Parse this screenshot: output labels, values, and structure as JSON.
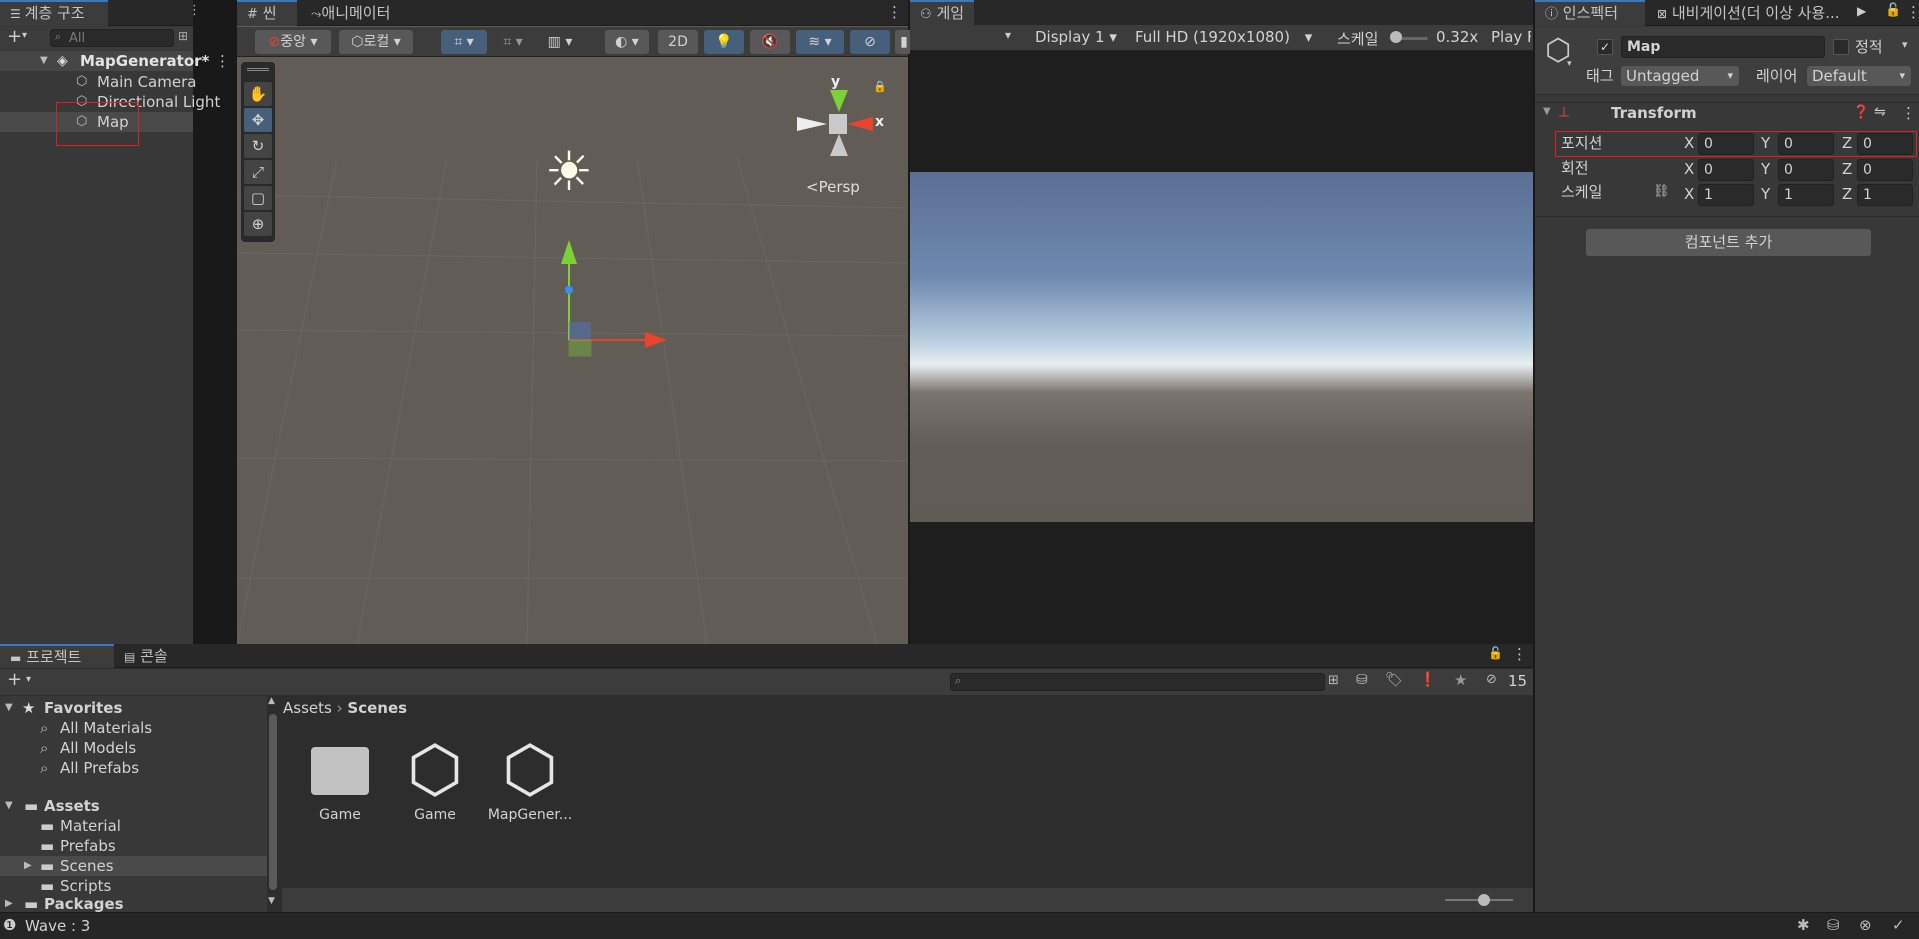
{
  "hierarchy": {
    "tab_label": "계층 구조",
    "search_placeholder": "All",
    "scene_name": "MapGenerator*",
    "items": [
      "Main Camera",
      "Directional Light",
      "Map"
    ]
  },
  "scene_view": {
    "tabs": [
      "씬",
      "애니메이터"
    ],
    "pivot_label": "중앙",
    "space_label": "로컬",
    "mode_2d": "2D",
    "persp_label": "Persp",
    "gizmo_y": "y",
    "gizmo_x": "x"
  },
  "game_view": {
    "tab_label": "게임",
    "display": "Display 1",
    "resolution": "Full HD (1920x1080)",
    "scale_label": "스케일",
    "scale_value": "0.32x",
    "play_label": "Play F"
  },
  "inspector": {
    "tabs": [
      "인스펙터",
      "내비게이션(더 이상 사용..."
    ],
    "object_name": "Map",
    "static_label": "정적",
    "tag_label": "태그",
    "tag_value": "Untagged",
    "layer_label": "레이어",
    "layer_value": "Default",
    "component_title": "Transform",
    "position_label": "포지션",
    "rotation_label": "회전",
    "scale_label": "스케일",
    "axis": [
      "X",
      "Y",
      "Z"
    ],
    "position": [
      "0",
      "0",
      "0"
    ],
    "rotation": [
      "0",
      "0",
      "0"
    ],
    "scale": [
      "1",
      "1",
      "1"
    ],
    "add_component": "컴포넌트 추가"
  },
  "project": {
    "tabs": [
      "프로젝트",
      "콘솔"
    ],
    "favorites_label": "Favorites",
    "favorites": [
      "All Materials",
      "All Models",
      "All Prefabs"
    ],
    "assets_label": "Assets",
    "assets": [
      "Material",
      "Prefabs",
      "Scenes",
      "Scripts"
    ],
    "packages_label": "Packages",
    "breadcrumb": [
      "Assets",
      "Scenes"
    ],
    "hidden_count": "15",
    "files": [
      "Game",
      "Game",
      "MapGener..."
    ]
  },
  "status": {
    "text": "Wave : 3"
  },
  "colors": {
    "accent": "#3a79bb",
    "highlight": "#e02020",
    "x_axis": "#e8442c",
    "y_axis": "#7bd136",
    "z_axis": "#3f8cf0"
  }
}
